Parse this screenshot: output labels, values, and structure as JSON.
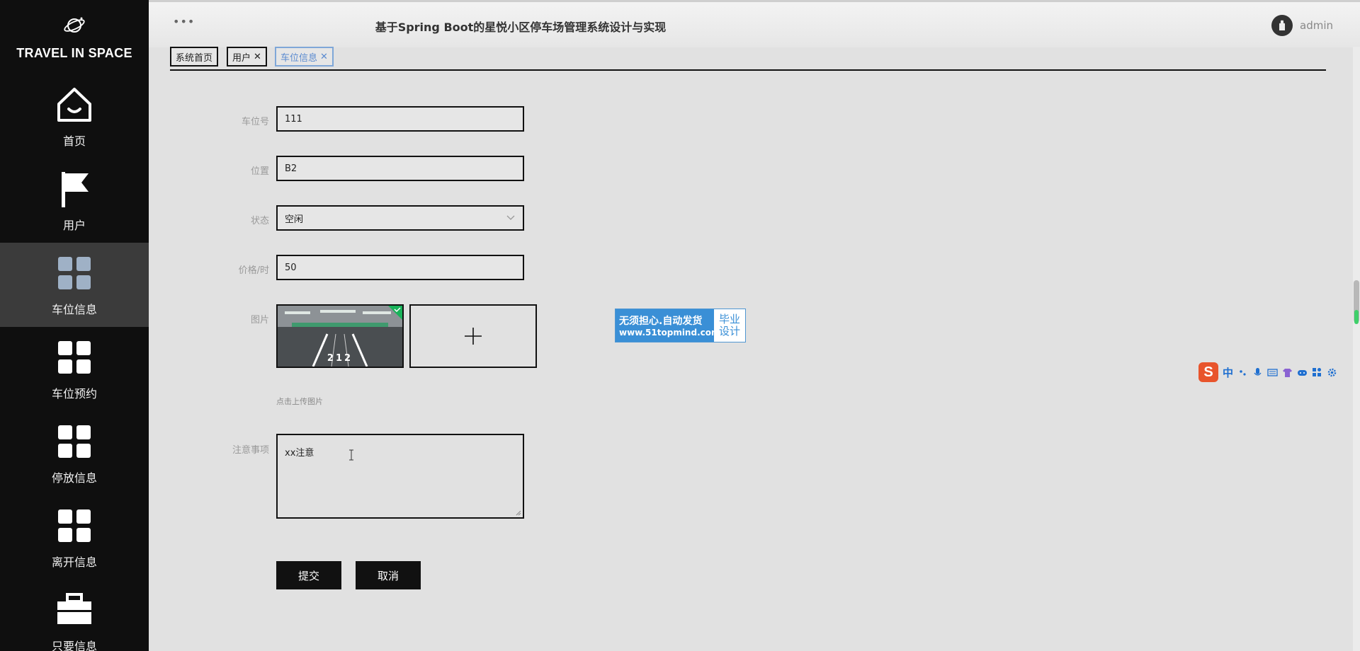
{
  "brand": {
    "title": "TRAVEL IN SPACE"
  },
  "sidebar": {
    "items": [
      {
        "label": "首页",
        "icon": "home-icon"
      },
      {
        "label": "用户",
        "icon": "flag-icon"
      },
      {
        "label": "车位信息",
        "icon": "grid-icon",
        "active": true
      },
      {
        "label": "车位预约",
        "icon": "grid-icon"
      },
      {
        "label": "停放信息",
        "icon": "grid-icon"
      },
      {
        "label": "离开信息",
        "icon": "grid-icon"
      },
      {
        "label": "只要信息",
        "icon": "briefcase-icon"
      }
    ]
  },
  "header": {
    "menu_dots": "•••",
    "title": "基于Spring Boot的星悦小区停车场管理系统设计与实现",
    "username": "admin"
  },
  "tabs": [
    {
      "label": "系统首页",
      "closable": false
    },
    {
      "label": "用户",
      "closable": true
    },
    {
      "label": "车位信息",
      "closable": true,
      "active": true
    }
  ],
  "form": {
    "spot_number": {
      "label": "车位号",
      "value": "111"
    },
    "location": {
      "label": "位置",
      "value": "B2"
    },
    "status": {
      "label": "状态",
      "value": "空闲"
    },
    "price": {
      "label": "价格/时",
      "value": "50"
    },
    "image": {
      "label": "图片",
      "hint": "点击上传图片",
      "thumb_text": "212"
    },
    "notes": {
      "label": "注意事项",
      "value": "xx注意"
    }
  },
  "buttons": {
    "submit": "提交",
    "cancel": "取消"
  },
  "watermark": {
    "line1": "无须担心.自动发货",
    "line2": "www.51topmind.com",
    "right1": "毕业",
    "right2": "设计"
  },
  "ime": {
    "logo": "S",
    "mode": "中"
  },
  "colors": {
    "sidebar_bg": "#0f0f0f",
    "active_nav": "#3b3b3b",
    "tab_active": "#5b8bd0",
    "page_bg": "#e1e1e1"
  }
}
